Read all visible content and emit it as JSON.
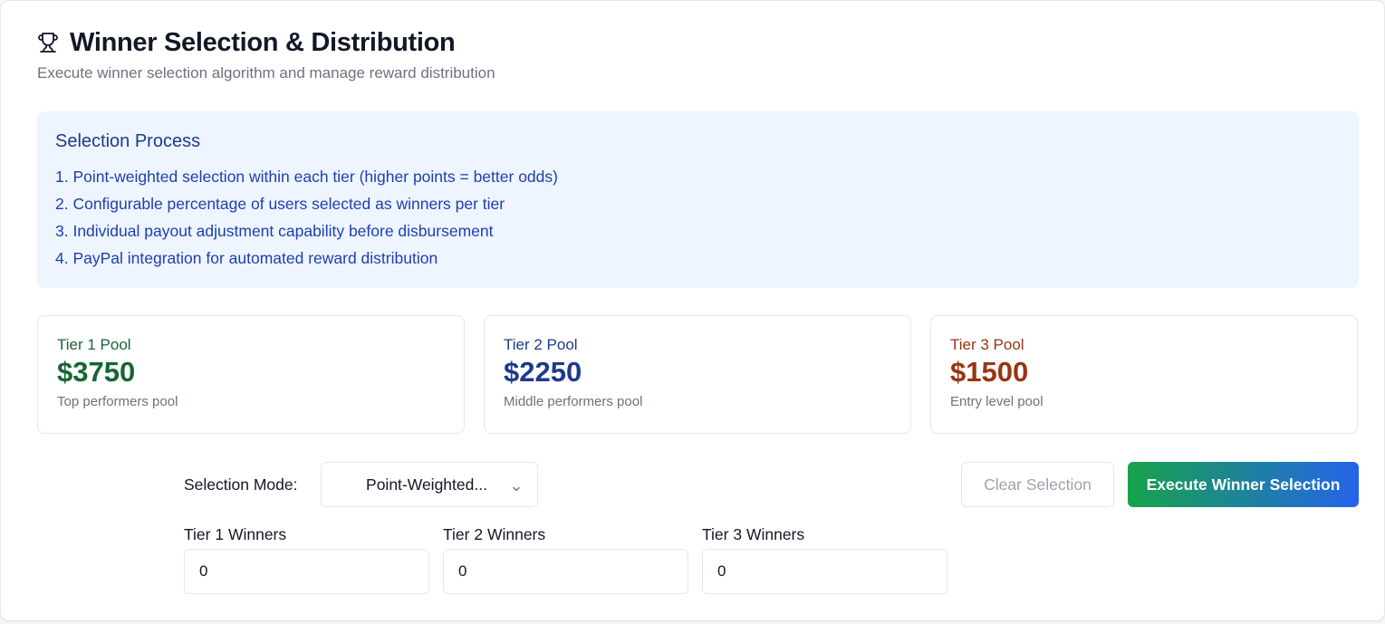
{
  "header": {
    "title": "Winner Selection & Distribution",
    "subtitle": "Execute winner selection algorithm and manage reward distribution",
    "icon": "trophy-icon"
  },
  "process": {
    "title": "Selection Process",
    "steps": [
      "1. Point-weighted selection within each tier (higher points = better odds)",
      "2. Configurable percentage of users selected as winners per tier",
      "3. Individual payout adjustment capability before disbursement",
      "4. PayPal integration for automated reward distribution"
    ]
  },
  "tiers": [
    {
      "label": "Tier 1 Pool",
      "amount": "$3750",
      "description": "Top performers pool",
      "color": "#166534"
    },
    {
      "label": "Tier 2 Pool",
      "amount": "$2250",
      "description": "Middle performers pool",
      "color": "#1e3a8a"
    },
    {
      "label": "Tier 3 Pool",
      "amount": "$1500",
      "description": "Entry level pool",
      "color": "#9a3412"
    }
  ],
  "controls": {
    "mode_label": "Selection Mode:",
    "mode_value": "Point-Weighted...",
    "clear_label": "Clear Selection",
    "execute_label": "Execute Winner Selection",
    "winners": [
      {
        "label": "Tier 1 Winners",
        "value": "0"
      },
      {
        "label": "Tier 2 Winners",
        "value": "0"
      },
      {
        "label": "Tier 3 Winners",
        "value": "0"
      }
    ]
  },
  "colors": {
    "accent_green": "#16a34a",
    "accent_blue": "#2563eb",
    "process_bg": "#eef5ff"
  }
}
